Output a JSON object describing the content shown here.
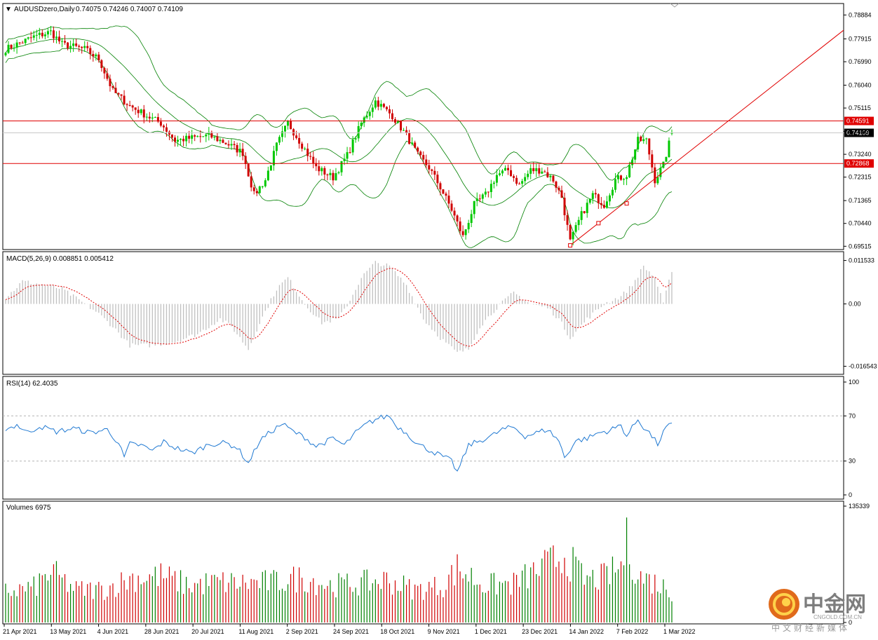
{
  "chart_data": {
    "type": "candlestick",
    "symbol_header": "AUDUSDzero,Daily",
    "ohlc_header": "0.74075 0.74246 0.74007 0.74109",
    "ohlc": {
      "open": 0.74075,
      "high": 0.74246,
      "low": 0.74007,
      "close": 0.74109
    },
    "price_ticks": [
      "0.78884",
      "0.77915",
      "0.76990",
      "0.76040",
      "0.75115",
      "0.74165",
      "0.73240",
      "0.72315",
      "0.71365",
      "0.70440",
      "0.69515"
    ],
    "price_range": [
      0.6941,
      0.7932
    ],
    "x_labels": [
      "21 Apr 2021",
      "13 May 2021",
      "4 Jun 2021",
      "28 Jun 2021",
      "20 Jul 2021",
      "11 Aug 2021",
      "2 Sep 2021",
      "24 Sep 2021",
      "18 Oct 2021",
      "9 Nov 2021",
      "1 Dec 2021",
      "23 Dec 2021",
      "14 Jan 2022",
      "7 Feb 2022",
      "1 Mar 2022"
    ],
    "horizontal_levels": [
      {
        "label": "0.74591",
        "value": 0.74591,
        "color": "#e00000"
      },
      {
        "label": "0.72868",
        "value": 0.72868,
        "color": "#e00000"
      }
    ],
    "current_price_label": "0.74109",
    "current_price": 0.74109,
    "close_anchors": [
      [
        0,
        0.775
      ],
      [
        10,
        0.78
      ],
      [
        16,
        0.782
      ],
      [
        20,
        0.777
      ],
      [
        28,
        0.775
      ],
      [
        33,
        0.771
      ],
      [
        38,
        0.758
      ],
      [
        44,
        0.752
      ],
      [
        50,
        0.748
      ],
      [
        55,
        0.745
      ],
      [
        60,
        0.738
      ],
      [
        66,
        0.739
      ],
      [
        72,
        0.74
      ],
      [
        78,
        0.737
      ],
      [
        84,
        0.733
      ],
      [
        88,
        0.716
      ],
      [
        92,
        0.722
      ],
      [
        96,
        0.736
      ],
      [
        100,
        0.745
      ],
      [
        104,
        0.738
      ],
      [
        110,
        0.727
      ],
      [
        116,
        0.723
      ],
      [
        121,
        0.732
      ],
      [
        126,
        0.745
      ],
      [
        131,
        0.754
      ],
      [
        137,
        0.748
      ],
      [
        142,
        0.74
      ],
      [
        146,
        0.732
      ],
      [
        150,
        0.727
      ],
      [
        154,
        0.719
      ],
      [
        158,
        0.71
      ],
      [
        162,
        0.699
      ],
      [
        166,
        0.712
      ],
      [
        170,
        0.716
      ],
      [
        174,
        0.724
      ],
      [
        178,
        0.726
      ],
      [
        182,
        0.72
      ],
      [
        186,
        0.726
      ],
      [
        190,
        0.726
      ],
      [
        194,
        0.722
      ],
      [
        197,
        0.715
      ],
      [
        200,
        0.697
      ],
      [
        204,
        0.708
      ],
      [
        208,
        0.716
      ],
      [
        212,
        0.712
      ],
      [
        216,
        0.722
      ],
      [
        220,
        0.724
      ],
      [
        224,
        0.738
      ],
      [
        227,
        0.738
      ],
      [
        230,
        0.722
      ],
      [
        233,
        0.728
      ],
      [
        236,
        0.741
      ]
    ],
    "candle_count": 237,
    "trendline": {
      "color": "#e00000",
      "anchors": [
        [
          200,
          0.6955
        ],
        [
          210,
          0.7045
        ],
        [
          220,
          0.7125
        ]
      ]
    },
    "bollinger": {
      "color": "#008000"
    },
    "macd": {
      "label": "MACD(5,26,9) 0.008851 0.005412",
      "ticks": [
        "0.011533",
        "0.00",
        "-0.016543"
      ],
      "range": [
        -0.0172,
        0.0122
      ],
      "anchors": [
        [
          0,
          0.0015
        ],
        [
          6,
          0.006
        ],
        [
          14,
          0.005
        ],
        [
          20,
          0.004
        ],
        [
          28,
          0.0
        ],
        [
          32,
          -0.002
        ],
        [
          38,
          -0.006
        ],
        [
          44,
          -0.011
        ],
        [
          52,
          -0.011
        ],
        [
          60,
          -0.01
        ],
        [
          68,
          -0.008
        ],
        [
          76,
          -0.004
        ],
        [
          80,
          -0.006
        ],
        [
          86,
          -0.012
        ],
        [
          90,
          -0.005
        ],
        [
          96,
          0.004
        ],
        [
          100,
          0.007
        ],
        [
          106,
          0.0
        ],
        [
          112,
          -0.005
        ],
        [
          118,
          -0.004
        ],
        [
          122,
          0.001
        ],
        [
          126,
          0.007
        ],
        [
          131,
          0.011
        ],
        [
          136,
          0.01
        ],
        [
          142,
          0.005
        ],
        [
          148,
          -0.004
        ],
        [
          154,
          -0.009
        ],
        [
          160,
          -0.013
        ],
        [
          164,
          -0.012
        ],
        [
          168,
          -0.006
        ],
        [
          174,
          -0.001
        ],
        [
          180,
          0.003
        ],
        [
          186,
          0.0
        ],
        [
          192,
          -0.001
        ],
        [
          196,
          -0.004
        ],
        [
          200,
          -0.009
        ],
        [
          206,
          -0.004
        ],
        [
          212,
          0.0
        ],
        [
          218,
          0.002
        ],
        [
          222,
          0.005
        ],
        [
          226,
          0.01
        ],
        [
          230,
          0.007
        ],
        [
          233,
          0.0
        ],
        [
          236,
          0.009
        ]
      ],
      "colors": {
        "histogram": "#c0c0c0",
        "signal": "#e00000"
      }
    },
    "rsi": {
      "label": "RSI(14) 62.4035",
      "ticks": [
        "100",
        "70",
        "30",
        "0"
      ],
      "levels": [
        70,
        30
      ],
      "range": [
        0,
        100
      ],
      "color": "#1e78d2",
      "anchors": [
        [
          0,
          58
        ],
        [
          4,
          62
        ],
        [
          8,
          55
        ],
        [
          12,
          61
        ],
        [
          18,
          56
        ],
        [
          24,
          59
        ],
        [
          30,
          55
        ],
        [
          36,
          58
        ],
        [
          40,
          46
        ],
        [
          42,
          33
        ],
        [
          44,
          45
        ],
        [
          48,
          44
        ],
        [
          52,
          39
        ],
        [
          56,
          47
        ],
        [
          60,
          42
        ],
        [
          66,
          37
        ],
        [
          72,
          45
        ],
        [
          78,
          46
        ],
        [
          82,
          42
        ],
        [
          86,
          28
        ],
        [
          90,
          48
        ],
        [
          94,
          56
        ],
        [
          98,
          63
        ],
        [
          102,
          56
        ],
        [
          106,
          51
        ],
        [
          110,
          43
        ],
        [
          116,
          50
        ],
        [
          120,
          44
        ],
        [
          124,
          55
        ],
        [
          128,
          63
        ],
        [
          132,
          68
        ],
        [
          136,
          70
        ],
        [
          138,
          62
        ],
        [
          142,
          55
        ],
        [
          146,
          45
        ],
        [
          150,
          40
        ],
        [
          154,
          35
        ],
        [
          158,
          30
        ],
        [
          160,
          20
        ],
        [
          164,
          44
        ],
        [
          168,
          48
        ],
        [
          172,
          52
        ],
        [
          176,
          58
        ],
        [
          180,
          60
        ],
        [
          184,
          52
        ],
        [
          188,
          55
        ],
        [
          192,
          58
        ],
        [
          196,
          48
        ],
        [
          198,
          33
        ],
        [
          202,
          48
        ],
        [
          206,
          50
        ],
        [
          210,
          55
        ],
        [
          214,
          57
        ],
        [
          218,
          62
        ],
        [
          220,
          52
        ],
        [
          224,
          67
        ],
        [
          226,
          60
        ],
        [
          228,
          55
        ],
        [
          231,
          45
        ],
        [
          234,
          60
        ],
        [
          236,
          62
        ]
      ]
    },
    "volumes": {
      "label": "Volumes 6975",
      "ticks": [
        "135339",
        "0"
      ],
      "max": 135339,
      "anchors": [
        [
          0,
          40
        ],
        [
          10,
          45
        ],
        [
          16,
          65
        ],
        [
          25,
          42
        ],
        [
          35,
          43
        ],
        [
          45,
          58
        ],
        [
          55,
          60
        ],
        [
          65,
          48
        ],
        [
          75,
          52
        ],
        [
          85,
          51
        ],
        [
          95,
          52
        ],
        [
          105,
          58
        ],
        [
          115,
          48
        ],
        [
          125,
          50
        ],
        [
          135,
          55
        ],
        [
          145,
          42
        ],
        [
          155,
          48
        ],
        [
          160,
          70
        ],
        [
          170,
          48
        ],
        [
          180,
          50
        ],
        [
          190,
          70
        ],
        [
          198,
          88
        ],
        [
          205,
          55
        ],
        [
          212,
          58
        ],
        [
          218,
          72
        ],
        [
          220,
          103
        ],
        [
          224,
          60
        ],
        [
          230,
          52
        ],
        [
          236,
          40
        ]
      ],
      "colors": {
        "up": "#008000",
        "down": "#d00000"
      }
    }
  },
  "watermark": {
    "brand": "中金网",
    "domain": "CNGOLD.COM.CN",
    "tagline": "中文财经新媒体"
  }
}
